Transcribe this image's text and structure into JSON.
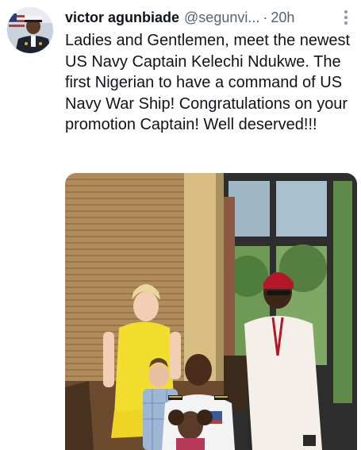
{
  "tweet": {
    "display_name": "victor agunbiade",
    "handle": "@segunvi...",
    "separator": "·",
    "timestamp": "20h",
    "text": "Ladies and Gentlemen, meet the newest US Navy Captain Kelechi Ndukwe. The first Nigerian to have a command of US Navy War Ship! Congratulations on your promotion Captain! Well deserved!!!",
    "avatar_icon": "profile-avatar",
    "more_icon": "more-vertical-icon"
  },
  "colors": {
    "text": "#0f1419",
    "muted": "#536471",
    "background": "#ffffff"
  }
}
